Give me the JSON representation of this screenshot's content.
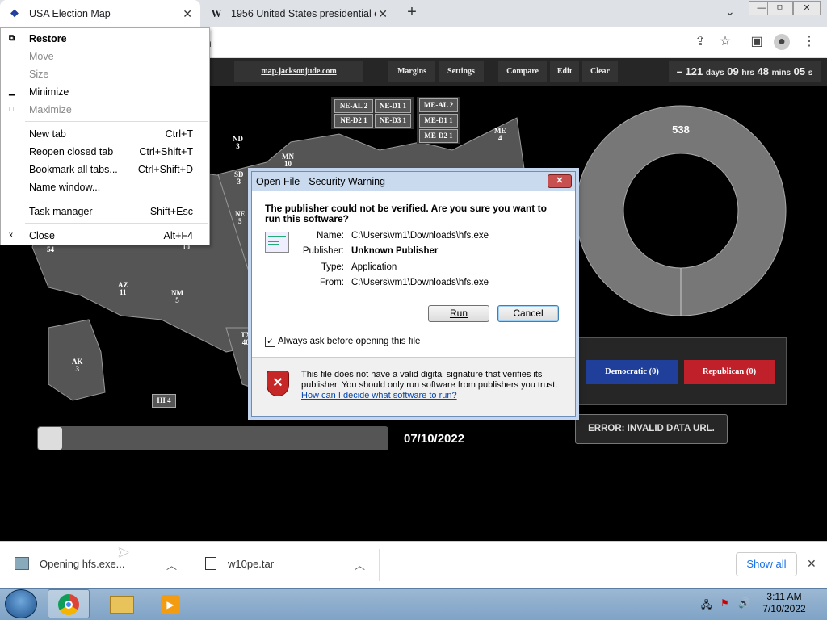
{
  "browser": {
    "tabs": [
      {
        "title": "USA Election Map",
        "favicon": "election-map-icon"
      },
      {
        "title": "1956 United States presidential e",
        "favicon": "W"
      }
    ],
    "url_fragment": "m",
    "window_controls": {
      "restore": "⧉",
      "minimize": "—",
      "close": "✕"
    }
  },
  "context_menu": {
    "items": [
      {
        "label": "Restore",
        "shortcut": "",
        "icon": "restore-icon",
        "disabled": false,
        "bold": true
      },
      {
        "label": "Move",
        "shortcut": "",
        "disabled": true
      },
      {
        "label": "Size",
        "shortcut": "",
        "disabled": true
      },
      {
        "label": "Minimize",
        "shortcut": "",
        "icon": "minimize-icon",
        "disabled": false
      },
      {
        "label": "Maximize",
        "shortcut": "",
        "icon": "maximize-icon",
        "disabled": true
      },
      {
        "label": "New tab",
        "shortcut": "Ctrl+T"
      },
      {
        "label": "Reopen closed tab",
        "shortcut": "Ctrl+Shift+T"
      },
      {
        "label": "Bookmark all tabs...",
        "shortcut": "Ctrl+Shift+D"
      },
      {
        "label": "Name window...",
        "shortcut": ""
      },
      {
        "label": "Task manager",
        "shortcut": "Shift+Esc"
      },
      {
        "label": "Close",
        "shortcut": "Alt+F4",
        "icon": "close-icon"
      }
    ]
  },
  "site": {
    "nav": {
      "home": "map.jacksonjude.com",
      "buttons": [
        "Margins",
        "Settings",
        "Compare",
        "Edit",
        "Clear"
      ],
      "countdown": {
        "prefix": "– 121",
        "days_unit": "days",
        "hours": "09",
        "hrs_unit": "hrs",
        "mins": "48",
        "mins_unit": "mins",
        "secs": "05",
        "secs_unit": "s"
      }
    },
    "states": [
      {
        "abbr": "ND",
        "ev": "3"
      },
      {
        "abbr": "SD",
        "ev": "3"
      },
      {
        "abbr": "MN",
        "ev": "10"
      },
      {
        "abbr": "NE",
        "ev": "5"
      },
      {
        "abbr": "AZ",
        "ev": "11"
      },
      {
        "abbr": "NM",
        "ev": "5"
      },
      {
        "abbr": "TX",
        "ev": "40"
      },
      {
        "abbr": "AK",
        "ev": "3"
      },
      {
        "abbr": "HI",
        "ev": "4"
      },
      {
        "abbr": "ME",
        "ev": "4"
      },
      {
        "abbr": "CA",
        "ev": "54"
      },
      {
        "abbr": "CO",
        "ev": "10"
      }
    ],
    "district_boxes": {
      "nebraska": [
        "NE-AL 2",
        "NE-D1 1",
        "NE-D2 1",
        "NE-D3 1"
      ],
      "maine": [
        "ME-AL 2",
        "ME-D1 1",
        "ME-D2 1"
      ]
    },
    "donut_total": "538",
    "parties": [
      {
        "label": "Democratic (0)",
        "color": "#1f3f9a"
      },
      {
        "label": "Republican (0)",
        "color": "#c0202a"
      }
    ],
    "error": "ERROR: INVALID DATA URL.",
    "date": "07/10/2022",
    "slider_position": 0.0
  },
  "dialog": {
    "title": "Open File - Security Warning",
    "close": "✕",
    "question": "The publisher could not be verified.  Are you sure you want to run this software?",
    "fields": [
      {
        "label": "Name:",
        "value": "C:\\Users\\vm1\\Downloads\\hfs.exe",
        "bold": false
      },
      {
        "label": "Publisher:",
        "value": "Unknown Publisher",
        "bold": true
      },
      {
        "label": "Type:",
        "value": "Application",
        "bold": false
      },
      {
        "label": "From:",
        "value": "C:\\Users\\vm1\\Downloads\\hfs.exe",
        "bold": false
      }
    ],
    "run_button": "Run",
    "cancel_button": "Cancel",
    "checkbox_label": "Always ask before opening this file",
    "checkbox_checked": true,
    "warning_text": "This file does not have a valid digital signature that verifies its publisher.  You should only run software from publishers you trust.",
    "help_link": "How can I decide what software to run?"
  },
  "downloads": {
    "items": [
      {
        "label": "Opening hfs.exe...",
        "icon": "installer-icon"
      },
      {
        "label": "w10pe.tar",
        "icon": "archive-icon"
      }
    ],
    "show_all": "Show all",
    "close": "✕"
  },
  "taskbar": {
    "time": "3:11 AM",
    "date": "7/10/2022"
  }
}
